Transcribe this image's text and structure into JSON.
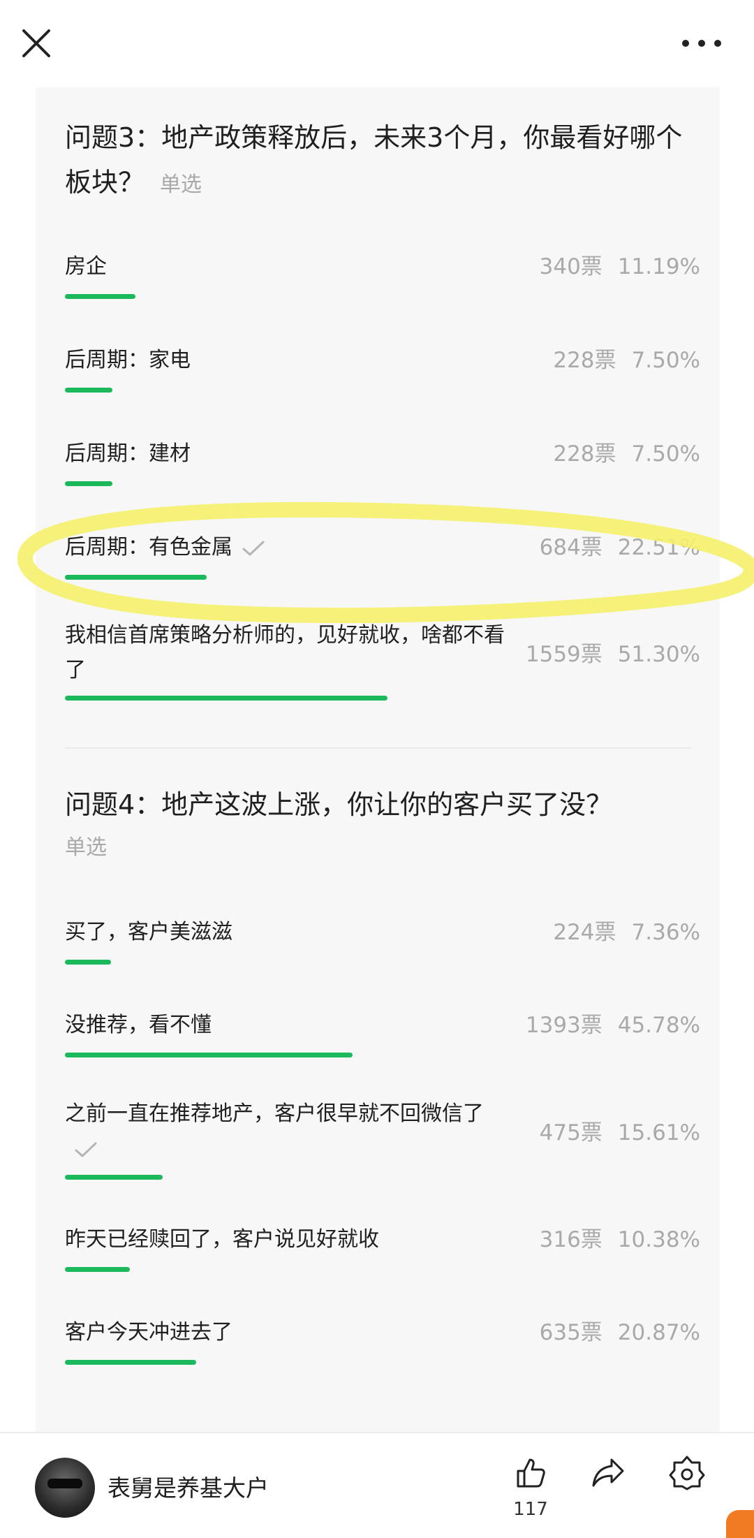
{
  "topbar": {
    "close_icon": "close-icon",
    "more_icon": "more-dots-icon"
  },
  "questions": [
    {
      "title": "问题3：地产政策释放后，未来3个月，你最看好哪个板块？",
      "type_label": "单选",
      "options": [
        {
          "label": "房企",
          "votes": "340票",
          "percent": "11.19%",
          "share": 0.1119,
          "selected": false
        },
        {
          "label": "后周期：家电",
          "votes": "228票",
          "percent": "7.50%",
          "share": 0.075,
          "selected": false
        },
        {
          "label": "后周期：建材",
          "votes": "228票",
          "percent": "7.50%",
          "share": 0.075,
          "selected": false
        },
        {
          "label": "后周期：有色金属",
          "votes": "684票",
          "percent": "22.51%",
          "share": 0.2251,
          "selected": true
        },
        {
          "label": "我相信首席策略分析师的，见好就收，啥都不看了",
          "votes": "1559票",
          "percent": "51.30%",
          "share": 0.513,
          "selected": false
        }
      ]
    },
    {
      "title": "问题4：地产这波上涨，你让你的客户买了没？",
      "type_label": "单选",
      "options": [
        {
          "label": "买了，客户美滋滋",
          "votes": "224票",
          "percent": "7.36%",
          "share": 0.0736,
          "selected": false
        },
        {
          "label": "没推荐，看不懂",
          "votes": "1393票",
          "percent": "45.78%",
          "share": 0.4578,
          "selected": false
        },
        {
          "label": "之前一直在推荐地产，客户很早就不回微信了",
          "votes": "475票",
          "percent": "15.61%",
          "share": 0.1561,
          "selected": true
        },
        {
          "label": "昨天已经赎回了，客户说见好就收",
          "votes": "316票",
          "percent": "10.38%",
          "share": 0.1038,
          "selected": false
        },
        {
          "label": "客户今天冲进去了",
          "votes": "635票",
          "percent": "20.87%",
          "share": 0.2087,
          "selected": false
        }
      ]
    }
  ],
  "colors": {
    "bar": "#1cb85c",
    "highlight": "#f4f06a",
    "muted_text": "#a9a9a9"
  },
  "bottom": {
    "author": "表舅是养基大户",
    "like_count": "117",
    "icons": [
      "like-icon",
      "share-icon",
      "settings-icon"
    ]
  }
}
